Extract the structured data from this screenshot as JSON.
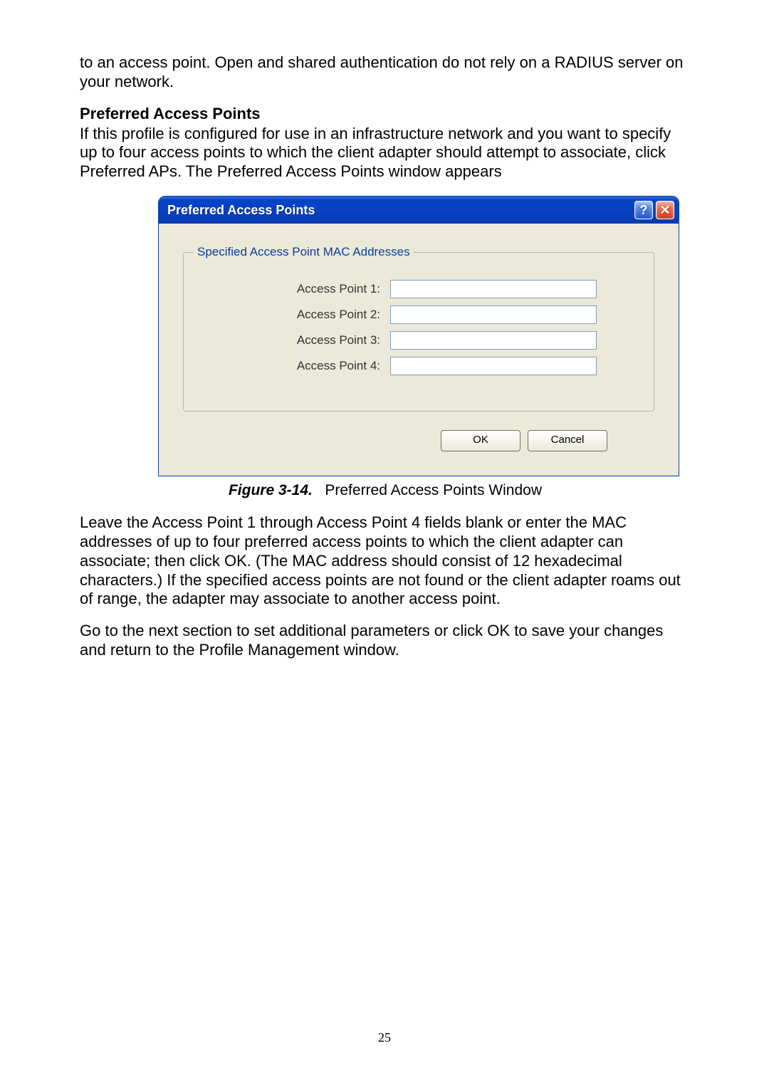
{
  "doc": {
    "para_top": "to an access point. Open and shared authentication do not rely on a RADIUS server on your network.",
    "heading": "Preferred Access Points",
    "para_intro": "If this profile is configured for use in an infrastructure network and you want to specify up to four access points to which the client adapter should attempt to associate, click Preferred APs. The Preferred Access Points window appears",
    "figure_label": "Figure 3-14.",
    "figure_caption": "Preferred Access Points Window",
    "para_after1": "Leave the Access Point 1 through Access Point 4 fields blank or enter the MAC addresses of up to four preferred access points to which the client adapter can associate; then click OK. (The MAC address should consist of 12 hexadecimal characters.) If the specified access points are not found or the client adapter roams out of range, the adapter may associate to another access point.",
    "para_after2": "Go to the next section to set additional parameters or click OK to save your changes and return to the Profile Management window.",
    "page_number": "25"
  },
  "dialog": {
    "title": "Preferred Access Points",
    "help_glyph": "?",
    "close_glyph": "✕",
    "group_legend": "Specified Access Point MAC Addresses",
    "fields": {
      "ap1_label": "Access Point 1:",
      "ap2_label": "Access Point 2:",
      "ap3_label": "Access Point 3:",
      "ap4_label": "Access Point 4:",
      "ap1_value": "",
      "ap2_value": "",
      "ap3_value": "",
      "ap4_value": ""
    },
    "ok_label": "OK",
    "cancel_label": "Cancel"
  }
}
